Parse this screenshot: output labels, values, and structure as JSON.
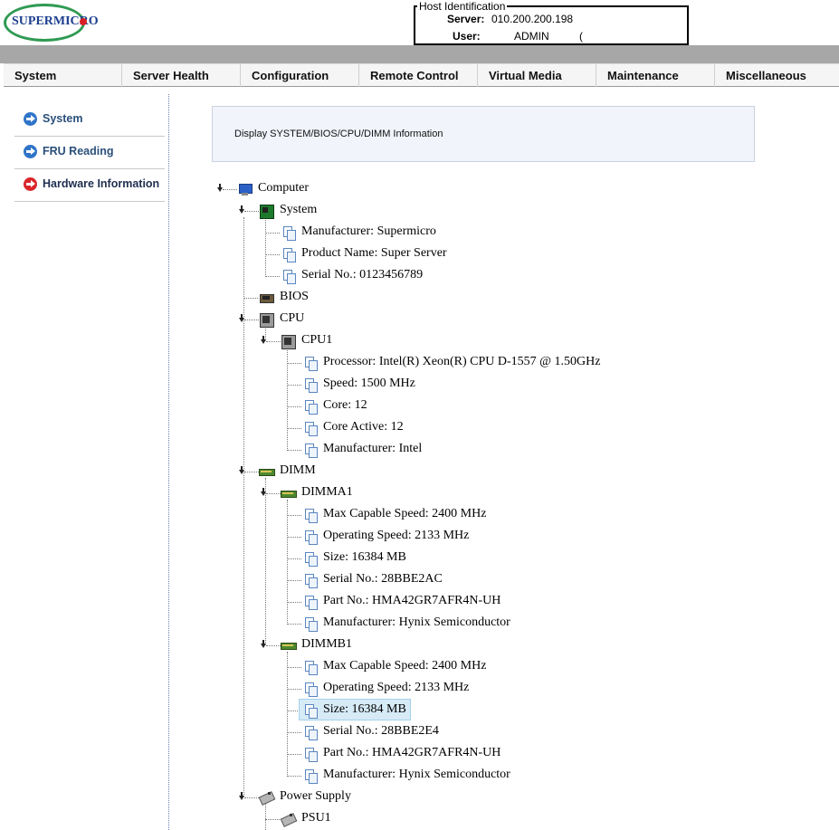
{
  "header": {
    "logo_text": "SUPERMICRO",
    "host_legend": "Host Identification",
    "server_label": "Server:",
    "server_value": "010.200.200.198",
    "user_label": "User:",
    "user_value": "ADMIN",
    "user_role": "( Administrator )"
  },
  "nav": [
    "System",
    "Server Health",
    "Configuration",
    "Remote Control",
    "Virtual Media",
    "Maintenance",
    "Miscellaneous"
  ],
  "sidebar": [
    {
      "label": "System",
      "active": false
    },
    {
      "label": "FRU Reading",
      "active": false
    },
    {
      "label": "Hardware Information",
      "active": true
    }
  ],
  "banner": "Display SYSTEM/BIOS/CPU/DIMM Information",
  "tree": {
    "computer": "Computer",
    "system": "System",
    "system_items": [
      "Manufacturer: Supermicro",
      "Product Name: Super Server",
      "Serial No.: 0123456789"
    ],
    "bios": "BIOS",
    "cpu": "CPU",
    "cpu1": "CPU1",
    "cpu1_items": [
      "Processor: Intel(R) Xeon(R) CPU D-1557 @ 1.50GHz",
      "Speed: 1500 MHz",
      "Core: 12",
      "Core Active: 12",
      "Manufacturer: Intel"
    ],
    "dimm": "DIMM",
    "dimma1": "DIMMA1",
    "dimma1_items": [
      "Max Capable Speed: 2400 MHz",
      "Operating Speed: 2133 MHz",
      "Size: 16384 MB",
      "Serial No.: 28BBE2AC",
      "Part No.: HMA42GR7AFR4N-UH",
      "Manufacturer: Hynix Semiconductor"
    ],
    "dimmb1": "DIMMB1",
    "dimmb1_items": [
      "Max Capable Speed: 2400 MHz",
      "Operating Speed: 2133 MHz",
      "Size: 16384 MB",
      "Serial No.: 28BBE2E4",
      "Part No.: HMA42GR7AFR4N-UH",
      "Manufacturer: Hynix Semiconductor"
    ],
    "power_supply": "Power Supply",
    "psu1": "PSU1"
  }
}
